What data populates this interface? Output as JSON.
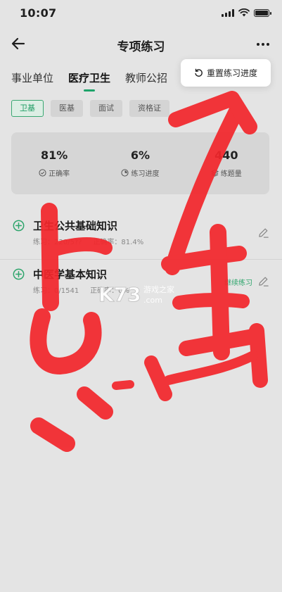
{
  "status_bar": {
    "time": "10:07"
  },
  "nav": {
    "title": "专项练习"
  },
  "category_tabs": [
    {
      "label": "事业单位",
      "active": false
    },
    {
      "label": "医疗卫生",
      "active": true
    },
    {
      "label": "教师公招",
      "active": false
    }
  ],
  "reset_popover": {
    "label": "重置练习进度"
  },
  "sub_tabs": [
    {
      "label": "卫基",
      "active": true
    },
    {
      "label": "医基",
      "active": false
    },
    {
      "label": "面试",
      "active": false
    },
    {
      "label": "资格证",
      "active": false
    }
  ],
  "stats": [
    {
      "value": "81%",
      "label": "正确率",
      "icon": "check-circle-icon"
    },
    {
      "value": "6%",
      "label": "练习进度",
      "icon": "progress-circle-icon"
    },
    {
      "value": "440",
      "label": "练题量",
      "icon": "layers-icon"
    }
  ],
  "subjects": [
    {
      "title": "卫生公共基础知识",
      "practiced": "练习：220/5??",
      "accuracy": "正确率：81.4%"
    },
    {
      "title": "中医学基本知识",
      "practiced": "练习：0/1541",
      "accuracy": "正确率：0%"
    }
  ],
  "continue_label": "继续练习",
  "watermark": {
    "brand": "K73",
    "text": "游戏之家",
    "domain": ".com"
  },
  "colors": {
    "accent": "#1ea36a",
    "scribble": "#f3262b",
    "background": "#e4e4e4"
  }
}
